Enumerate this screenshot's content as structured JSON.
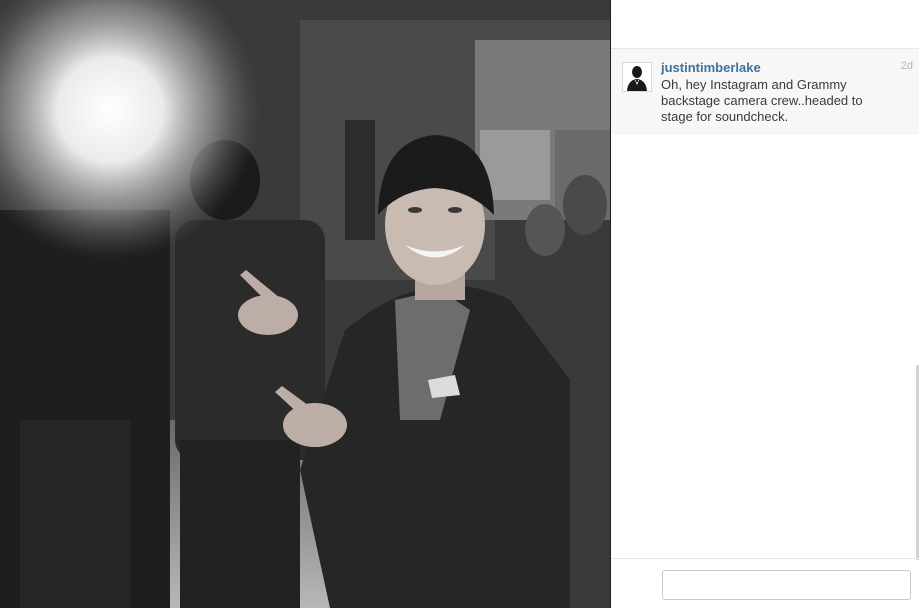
{
  "post": {
    "username": "justintimberlake",
    "timestamp": "2d",
    "caption": "Oh, hey Instagram and Grammy backstage camera crew..headed to stage for soundcheck."
  },
  "comment_box": {
    "placeholder": "",
    "value": ""
  },
  "colors": {
    "username": "#3f729b",
    "timestamp": "#b5b5b5",
    "caption": "#3a3a3a",
    "comment_bg": "#f7f7f7"
  },
  "icons": {
    "avatar": "profile-avatar"
  }
}
